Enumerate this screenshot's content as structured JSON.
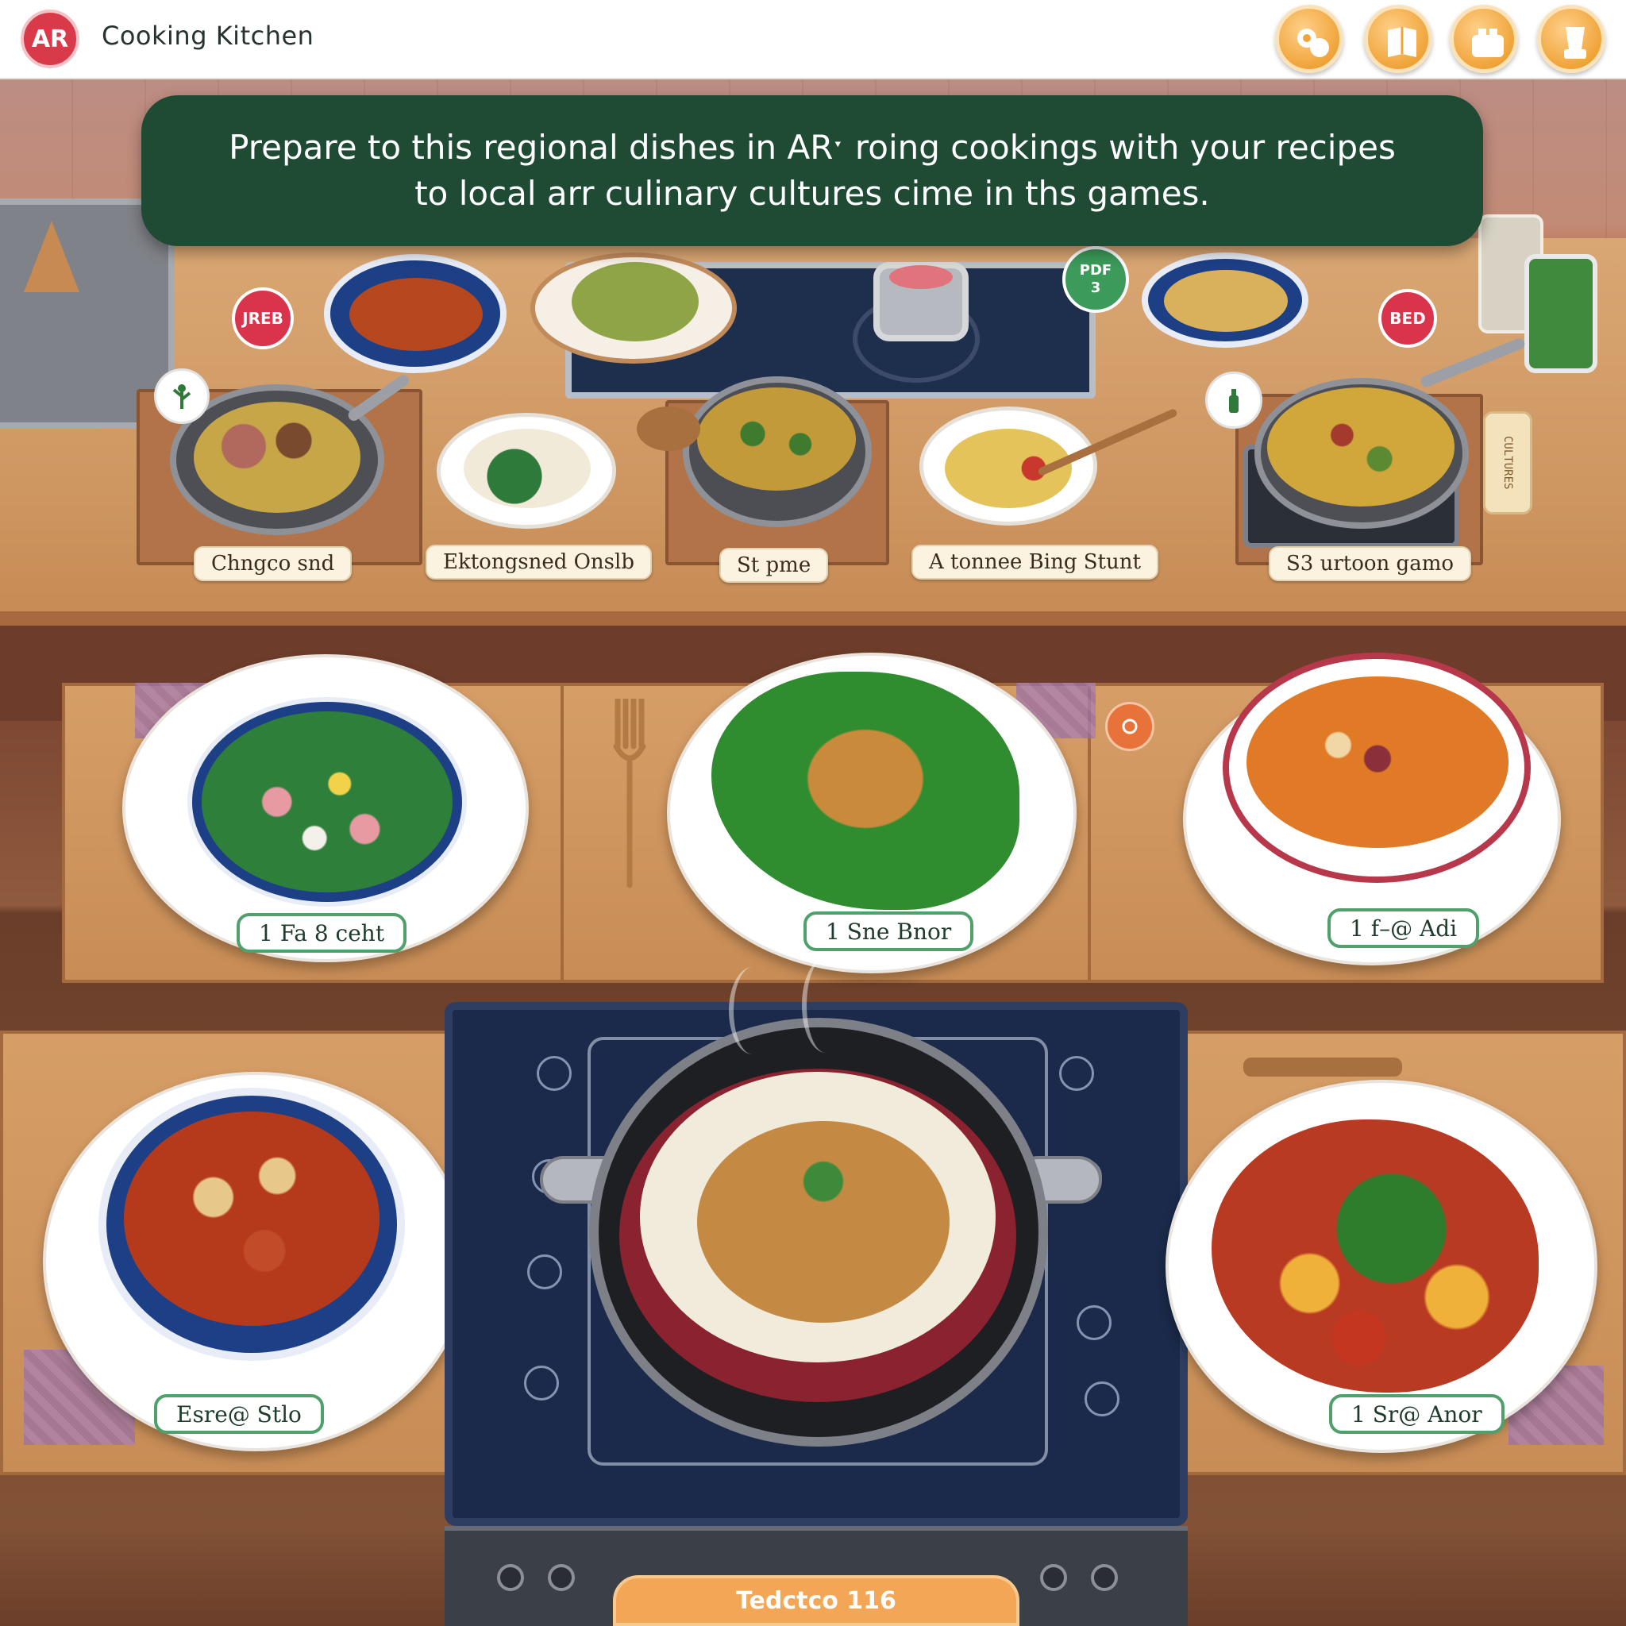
{
  "header": {
    "logo_text": "AR",
    "title": "Cooking Kitchen",
    "tools": [
      {
        "icon": "ingredients-icon"
      },
      {
        "icon": "recipe-book-icon"
      },
      {
        "icon": "toaster-icon"
      },
      {
        "icon": "blender-icon"
      }
    ]
  },
  "banner": {
    "line1": "Prepare to this regional dishes in ARˑ roing cookings with your recipes",
    "line2": "to local  arr culinary cultures cime in ths games."
  },
  "counter_markers": {
    "left": "JREB",
    "center": "PDF\n3",
    "right": "BED"
  },
  "counter_dishes": [
    {
      "label": "Chngco snd"
    },
    {
      "label": "Ektongsned Onslb"
    },
    {
      "label": "St pme"
    },
    {
      "label": "A tonnee Bing Stunt"
    },
    {
      "label": "S3 urtoon gamo"
    }
  ],
  "spice_label": "CULTURES",
  "served_dishes": [
    {
      "label": "1 Fa 8 ceht"
    },
    {
      "label": "1 Sne Bnor"
    },
    {
      "label": "1 f–@ Adi"
    },
    {
      "label": "Esre@ Stlo"
    },
    {
      "label": "1 Sr@ Anor"
    }
  ],
  "start_button": "Tedctco 116",
  "colors": {
    "banner": "#1f4a34",
    "accent_orange": "#f2a656",
    "logo_red": "#d83a4a",
    "label_green": "#4fa06a"
  }
}
